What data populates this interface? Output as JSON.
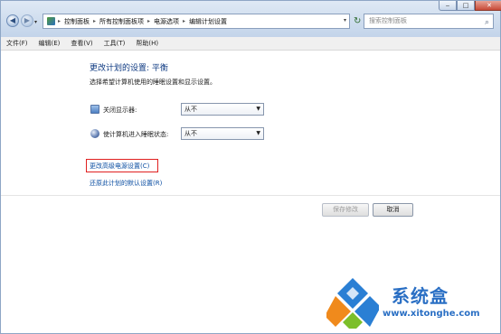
{
  "window": {
    "controls": {
      "minimize": "‒",
      "maximize": "□",
      "close": "✕"
    }
  },
  "address_bar": {
    "crumbs": [
      "控制面板",
      "所有控制面板项",
      "电源选项",
      "编辑计划设置"
    ],
    "search_placeholder": "搜索控制面板"
  },
  "menu": [
    "文件(F)",
    "编辑(E)",
    "查看(V)",
    "工具(T)",
    "帮助(H)"
  ],
  "content": {
    "title": "更改计划的设置: 平衡",
    "subtitle": "选择希望计算机使用的睡眠设置和显示设置。",
    "settings": [
      {
        "label": "关闭显示器:",
        "value": "从不",
        "icon": "monitor-icon"
      },
      {
        "label": "使计算机进入睡眠状态:",
        "value": "从不",
        "icon": "sleep-icon"
      }
    ],
    "links": {
      "advanced": "更改高级电源设置(C)",
      "restore": "还原此计划的默认设置(R)"
    },
    "buttons": {
      "save": "保存修改",
      "cancel": "取消"
    }
  },
  "watermark": {
    "title": "系统盒",
    "url": "www.xitonghe.com"
  },
  "colors": {
    "link": "#0b4ea2",
    "title": "#0e3a82",
    "highlight_box": "#e02020",
    "watermark": "#2a6fc4"
  }
}
